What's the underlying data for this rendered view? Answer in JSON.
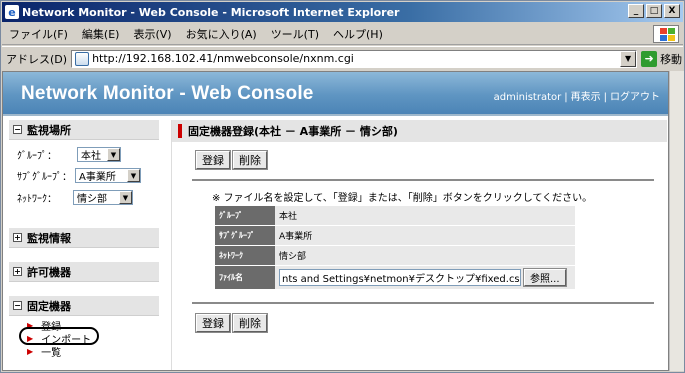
{
  "window": {
    "title": "Network Monitor - Web Console - Microsoft Internet Explorer",
    "controls": [
      "_",
      "□",
      "X"
    ]
  },
  "menu": [
    "ファイル(F)",
    "編集(E)",
    "表示(V)",
    "お気に入り(A)",
    "ツール(T)",
    "ヘルプ(H)"
  ],
  "address": {
    "label": "アドレス(D)",
    "url": "http://192.168.102.41/nmwebconsole/nxnm.cgi",
    "go_label": "移動"
  },
  "header": {
    "title": "Network Monitor - Web Console",
    "links": [
      "administrator",
      "再表示",
      "ログアウト"
    ]
  },
  "sidebar": {
    "monitor_location": {
      "title": "監視場所",
      "toggle": "−",
      "group_label": "ｸﾞﾙｰﾌﾟ：",
      "group_value": "本社",
      "subgroup_label": "ｻﾌﾞｸﾞﾙｰﾌﾟ：",
      "subgroup_value": "A事業所",
      "network_label": "ﾈｯﾄﾜｰｸ：",
      "network_value": "情シ部"
    },
    "monitor_info": {
      "title": "監視情報",
      "toggle": "+"
    },
    "permitted": {
      "title": "許可機器",
      "toggle": "+"
    },
    "fixed": {
      "title": "固定機器",
      "toggle": "−",
      "items": [
        "登録",
        "インポート",
        "一覧"
      ]
    }
  },
  "main": {
    "title": "固定機器登録(本社 － A事業所 － 情シ部)",
    "register_label": "登録",
    "delete_label": "削除",
    "notice": "※ ファイル名を設定して、「登録」または、「削除」ボタンをクリックしてください。",
    "rows": [
      {
        "label": "ｸﾞﾙｰﾌﾟ",
        "value": "本社"
      },
      {
        "label": "ｻﾌﾞｸﾞﾙｰﾌﾟ",
        "value": "A事業所"
      },
      {
        "label": "ﾈｯﾄﾜｰｸ",
        "value": "情シ部"
      }
    ],
    "file_label": "ﾌｧｲﾙ名",
    "file_value": "nts and Settings¥netmon¥デスクトップ¥fixed.csv",
    "browse_label": "参照..."
  }
}
